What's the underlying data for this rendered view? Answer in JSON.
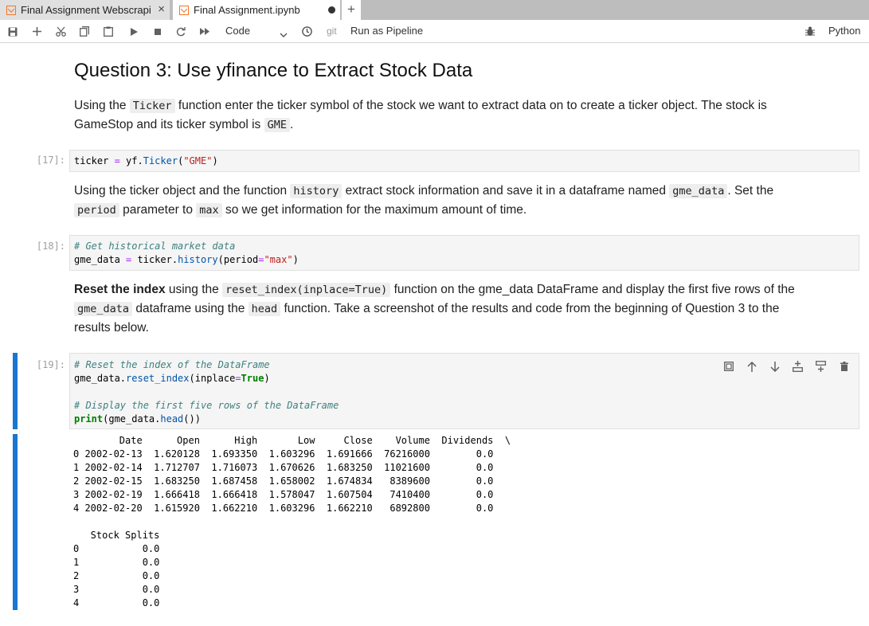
{
  "tabs": [
    {
      "label": "Final Assignment Webscrapi",
      "close": "×"
    },
    {
      "label": "Final Assignment.ipynb"
    }
  ],
  "new_tab_label": "+",
  "toolbar": {
    "cell_type": "Code",
    "git_label": "git",
    "pipeline_label": "Run as Pipeline",
    "kernel_name": "Python"
  },
  "heading": "Question 3: Use yfinance to Extract Stock Data",
  "md1": {
    "t1": "Using the ",
    "c1": "Ticker",
    "t2": " function enter the ticker symbol of the stock we want to extract data on to create a ticker object. The stock is",
    "t3": "GameStop and its ticker symbol is ",
    "c2": "GME",
    "t4": "."
  },
  "cell17": {
    "prompt": "[17]:",
    "code_a": "ticker ",
    "code_eq": "=",
    "code_b": " yf.",
    "code_fn": "Ticker",
    "code_c": "(",
    "code_str": "\"GME\"",
    "code_d": ")"
  },
  "md2": {
    "t1": "Using the ticker object and the function ",
    "c1": "history",
    "t2": " extract stock information and save it in a dataframe named ",
    "c2": "gme_data",
    "t3": ". Set the",
    "c3": "period",
    "t4": " parameter to ",
    "c4": "max",
    "t5": " so we get information for the maximum amount of time."
  },
  "cell18": {
    "prompt": "[18]:",
    "comment": "# Get historical market data",
    "l2_a": "gme_data ",
    "l2_eq": "=",
    "l2_b": " ticker.",
    "l2_fn": "history",
    "l2_c": "(period",
    "l2_eq2": "=",
    "l2_str": "\"max\"",
    "l2_d": ")"
  },
  "md3": {
    "bold": "Reset the index",
    "t1": " using the ",
    "c1": "reset_index(inplace=True)",
    "t2": " function on the gme_data DataFrame and display the first five rows of the",
    "c2": "gme_data",
    "t3": " dataframe using the ",
    "c3": "head",
    "t4": " function. Take a screenshot of the results and code from the beginning of Question 3 to the",
    "t5": "results below."
  },
  "cell19": {
    "prompt": "[19]:",
    "comment1": "# Reset the index of the DataFrame",
    "l2_a": "gme_data.",
    "l2_fn": "reset_index",
    "l2_b": "(inplace",
    "l2_eq": "=",
    "l2_kw": "True",
    "l2_c": ")",
    "comment2": "# Display the first five rows of the DataFrame",
    "l5_print": "print",
    "l5_a": "(gme_data.",
    "l5_fn": "head",
    "l5_b": "())"
  },
  "output": {
    "header": "        Date      Open      High       Low     Close    Volume  Dividends  \\",
    "rows": [
      "0 2002-02-13  1.620128  1.693350  1.603296  1.691666  76216000        0.0",
      "1 2002-02-14  1.712707  1.716073  1.670626  1.683250  11021600        0.0",
      "2 2002-02-15  1.683250  1.687458  1.658002  1.674834   8389600        0.0",
      "3 2002-02-19  1.666418  1.666418  1.578047  1.607504   7410400        0.0",
      "4 2002-02-20  1.615920  1.662210  1.603296  1.662210   6892800        0.0"
    ],
    "splits_header": "   Stock Splits",
    "splits_rows": [
      "0           0.0",
      "1           0.0",
      "2           0.0",
      "3           0.0",
      "4           0.0"
    ]
  }
}
